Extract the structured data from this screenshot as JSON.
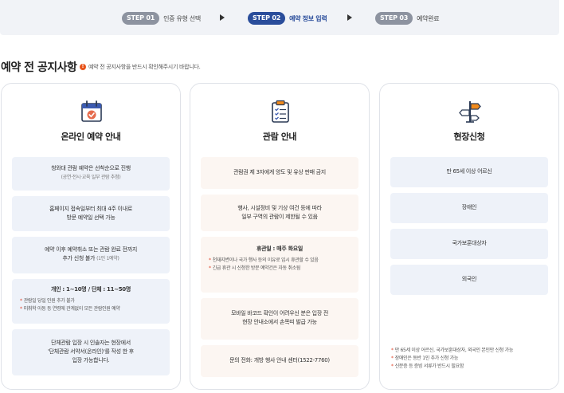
{
  "steps": [
    {
      "badge": "STEP 01",
      "label": "인증 유형 선택",
      "active": false
    },
    {
      "badge": "STEP 02",
      "label": "예약 정보 입력",
      "active": true
    },
    {
      "badge": "STEP 03",
      "label": "예약완료",
      "active": false
    }
  ],
  "page": {
    "title": "예약 전 공지사항",
    "notice_icon": "!",
    "notice": "예약 전 공지사항을 반드시 확인해주시기 바랍니다."
  },
  "cards": [
    {
      "icon": "calendar-check-icon",
      "title": "온라인 예약 안내",
      "boxes": [
        {
          "lines": [
            "청와대 관람 예약은 선착순으로 진행"
          ],
          "sub": "(공연·전시·교육 일부 관람 추첨)"
        },
        {
          "lines": [
            "홈페이지 접속일부터 최대 4주 이내로",
            "방문 예약일 선택 가능"
          ]
        },
        {
          "line1": "예약 이후 예약취소 또는 관람 완료 전까지",
          "line2_main": "추가 신청 불가",
          "line2_sub": "(1인 1예약)"
        },
        {
          "bold": "개인 : 1~10명 / 단체 : 11~50명",
          "notes": [
            "관람일 당일 인원 추가 불가",
            "미취학 아동 등 연령에 관계없이 모든 관람인원 예약"
          ]
        },
        {
          "lines": [
            "단체관람 입장 시 인솔자는 현장에서",
            "'단체관람 서약서(온라인)'를 작성 한 후",
            "입장 가능합니다."
          ]
        }
      ]
    },
    {
      "icon": "clipboard-check-icon",
      "title": "관람 안내",
      "boxes": [
        {
          "lines": [
            "관람권 제 3자에게 양도 및 유상 판매 금지"
          ]
        },
        {
          "lines": [
            "행사, 시설정비 및 기상 여건 등에 따라",
            "일부 구역의 관람이 제한될 수 있음"
          ]
        },
        {
          "bold": "휴관일 : 매주 화요일",
          "notes": [
            "천재지변이나 국가 행사 등의 이유로 임시 휴관할 수 있음",
            "긴급 휴관 시 신청한 방문 예약건은 자동 취소됨"
          ]
        },
        {
          "lines": [
            "모바일 바코드 확인이 어려우신 분은 입장 전",
            "현장 안내소에서 손목띠 발급 가능"
          ]
        },
        {
          "lines": [
            "문의 전화: 개방 행사 안내 센터(1522-7760)"
          ]
        }
      ]
    },
    {
      "icon": "signpost-icon",
      "title": "현장신청",
      "boxes": [
        {
          "lines": [
            "만 65세 이상 어르신"
          ]
        },
        {
          "lines": [
            "장애인"
          ]
        },
        {
          "lines": [
            "국가보훈대상자"
          ]
        },
        {
          "lines": [
            "외국인"
          ]
        }
      ],
      "notes": [
        "만 65세 이상 어르신, 국가보훈대상자, 외국인 본인만 신청 가능",
        "장애인은 동반 1인 추가 신청 가능",
        "신분증 등 증빙 서류가 반드시 필요함"
      ]
    }
  ],
  "colors": {
    "active_step": "#2a4d9b",
    "inactive_step": "#8d93a0",
    "accent_red": "#e0452b",
    "icon_orange": "#f08a1c"
  }
}
